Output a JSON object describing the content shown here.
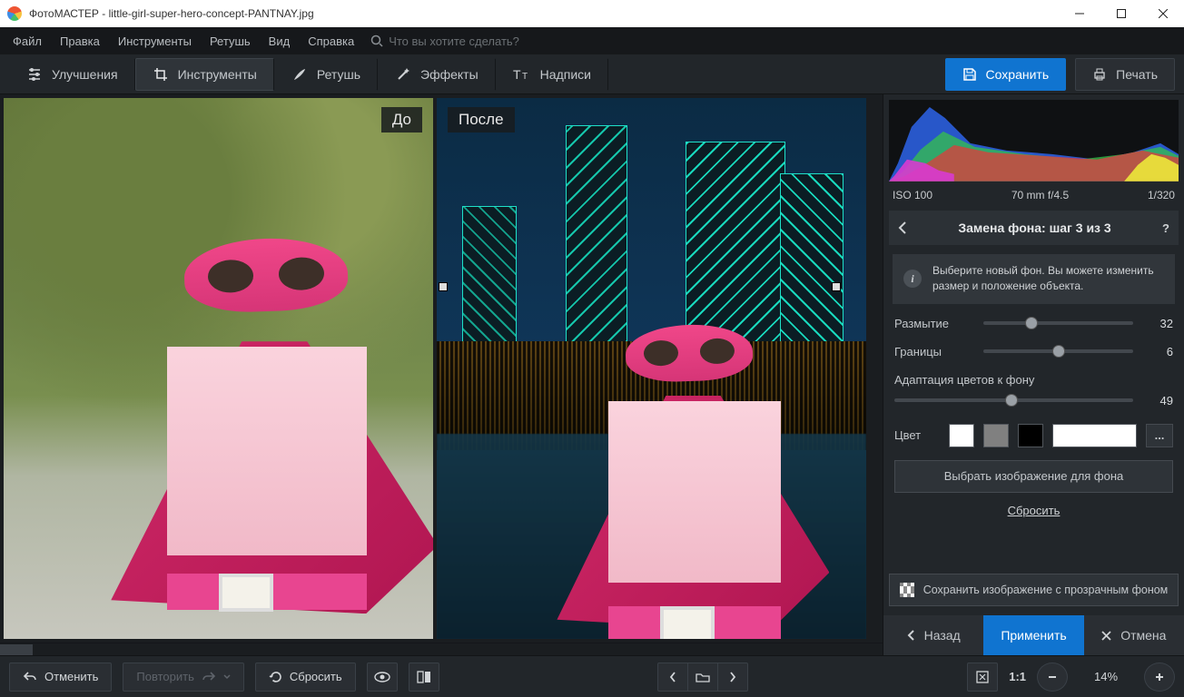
{
  "window": {
    "title": "ФотоМАСТЕР - little-girl-super-hero-concept-PANTNAY.jpg"
  },
  "menubar": {
    "file": "Файл",
    "edit": "Правка",
    "tools": "Инструменты",
    "retouch": "Ретушь",
    "view": "Вид",
    "help": "Справка",
    "search_placeholder": "Что вы хотите сделать?"
  },
  "toolbar": {
    "enhance": "Улучшения",
    "tools": "Инструменты",
    "retouch": "Ретушь",
    "effects": "Эффекты",
    "text": "Надписи",
    "save": "Сохранить",
    "print": "Печать"
  },
  "canvas": {
    "before_label": "До",
    "after_label": "После"
  },
  "exif": {
    "iso": "ISO 100",
    "lens": "70 mm f/4.5",
    "shutter": "1/320"
  },
  "panel": {
    "title": "Замена фона: шаг 3 из 3",
    "hint": "Выберите новый фон. Вы можете изменить размер и положение объекта.",
    "blur_label": "Размытие",
    "blur_value": "32",
    "blur_pct": 32,
    "edges_label": "Границы",
    "edges_value": "6",
    "edges_pct": 50,
    "adapt_label": "Адаптация цветов к фону",
    "adapt_value": "49",
    "adapt_pct": 49,
    "color_label": "Цвет",
    "more": "...",
    "choose_bg": "Выбрать изображение для фона",
    "reset": "Сбросить",
    "save_transparent": "Сохранить изображение с прозрачным фоном",
    "back": "Назад",
    "apply": "Применить",
    "cancel": "Отмена"
  },
  "bottom": {
    "undo": "Отменить",
    "redo": "Повторить",
    "reset": "Сбросить",
    "ratio": "1:1",
    "zoom": "14%"
  }
}
